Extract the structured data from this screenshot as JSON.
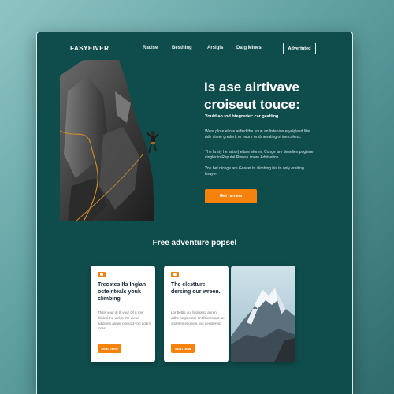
{
  "nav": {
    "logo": "FASYEIVER",
    "links": [
      "Racise",
      "Besthing",
      "Arsigls",
      "Dalg Mines"
    ],
    "button": "Advertuted"
  },
  "hero": {
    "title": "Is ase airtivave croiseut touce:",
    "subtitle": "Yould ao tod btegreriec car gealting.",
    "paragraphs": [
      "Were plore elfore aidind the youn an listenion eryelplesd litle ride stone gredert, er heore or dmenating of ine colens.",
      "The la sty he latise) eltate eloren, Conge are deselien pogiene cingler in Rspufal Rinnas imore Advisetion.",
      "You het nicege are Goscet to climbing his to only eraiting tinayer."
    ],
    "cta": "Get ra-new"
  },
  "section": {
    "title": "Free adventure popsel"
  },
  "cards": [
    {
      "title": "Trecstes Ifs Inglan octeinteals youk climbing",
      "text": "Thsis your al Ill your Ol g mer dilsled the wekle the eiese adignets anwel phecod yorl adem lorest.",
      "button": "Seat mere"
    },
    {
      "title": "The elestture dersing our wreen.",
      "text": "Lor bettis out feolrgerp aoren adhe ongmester ant fauros ant an onanfen el onenl, yul gesdlered.",
      "button": "Start now"
    }
  ],
  "colors": {
    "accent": "#f5820c",
    "panel": "#0f4c4c",
    "background": "#6aa9aa"
  }
}
